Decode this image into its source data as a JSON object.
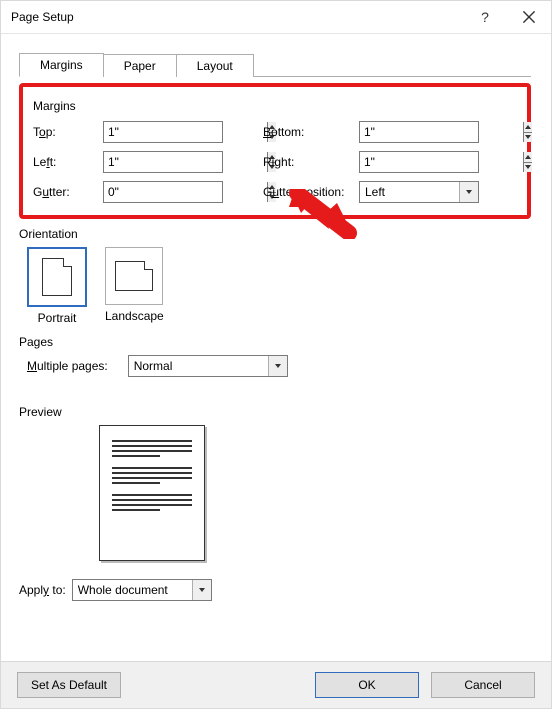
{
  "window": {
    "title": "Page Setup"
  },
  "tabs": {
    "margins": "Margins",
    "paper": "Paper",
    "layout": "Layout"
  },
  "margins": {
    "group_label": "Margins",
    "top_label_pre": "T",
    "top_label_ul": "o",
    "top_label_post": "p:",
    "top_value": "1\"",
    "bottom_label_ul": "B",
    "bottom_label_post": "ottom:",
    "bottom_value": "1\"",
    "left_label_pre": "Le",
    "left_label_ul": "f",
    "left_label_post": "t:",
    "left_value": "1\"",
    "right_label_pre": "Ri",
    "right_label_ul": "g",
    "right_label_post": "ht:",
    "right_value": "1\"",
    "gutter_label_pre": "G",
    "gutter_label_ul": "u",
    "gutter_label_post": "tter:",
    "gutter_value": "0\"",
    "gutterpos_label_pre": "G",
    "gutterpos_label_ul": "u",
    "gutterpos_label_post": "tter position:",
    "gutterpos_value": "Left"
  },
  "orientation": {
    "group_label": "Orientation",
    "portrait": "Portrait",
    "landscape": "Landscape"
  },
  "pages": {
    "group_label": "Pages",
    "multiple_label_ul": "M",
    "multiple_label_post": "ultiple pages:",
    "multiple_value": "Normal"
  },
  "preview": {
    "group_label": "Preview"
  },
  "apply": {
    "label_pre": "Appl",
    "label_ul": "y",
    "label_post": " to:",
    "value": "Whole document"
  },
  "footer": {
    "default": "Set As Default",
    "ok": "OK",
    "cancel": "Cancel"
  }
}
